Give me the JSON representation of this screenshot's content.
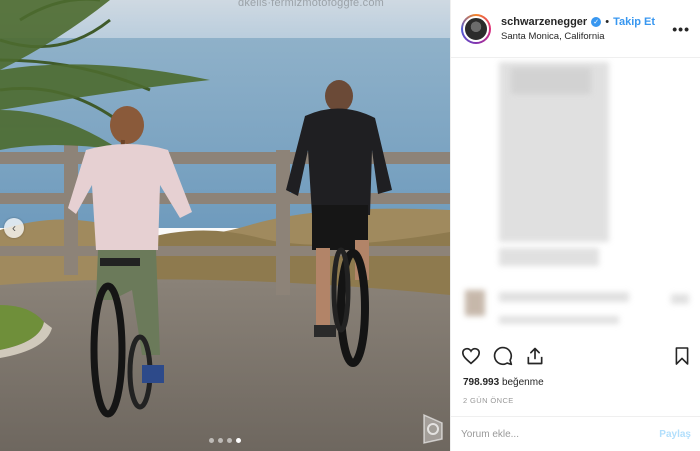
{
  "photo": {
    "watermark_text": "dkelis·fermizmotofoggfe.com",
    "slides_total": 4,
    "slide_active": 4,
    "prev_icon": "chevron-left-icon",
    "prev_glyph": "‹"
  },
  "header": {
    "username": "schwarzenegger",
    "verified_icon": "verified-badge-icon",
    "verified_glyph": "✓",
    "separator": "•",
    "follow_label": "Takip Et",
    "location": "Santa Monica, California",
    "more_label": "•••"
  },
  "actions": {
    "like_icon": "heart-icon",
    "comment_icon": "comment-icon",
    "share_icon": "share-icon",
    "save_icon": "bookmark-icon"
  },
  "stats": {
    "likes_count": "798.993",
    "likes_suffix": "beğenme",
    "time_ago": "2 GÜN ÖNCE"
  },
  "comment_box": {
    "placeholder": "Yorum ekle...",
    "post_label": "Paylaş"
  },
  "colors": {
    "accent": "#3897f0",
    "post_disabled": "#b2dffc",
    "text_primary": "#262626",
    "text_secondary": "#999999",
    "border": "#efefef"
  }
}
